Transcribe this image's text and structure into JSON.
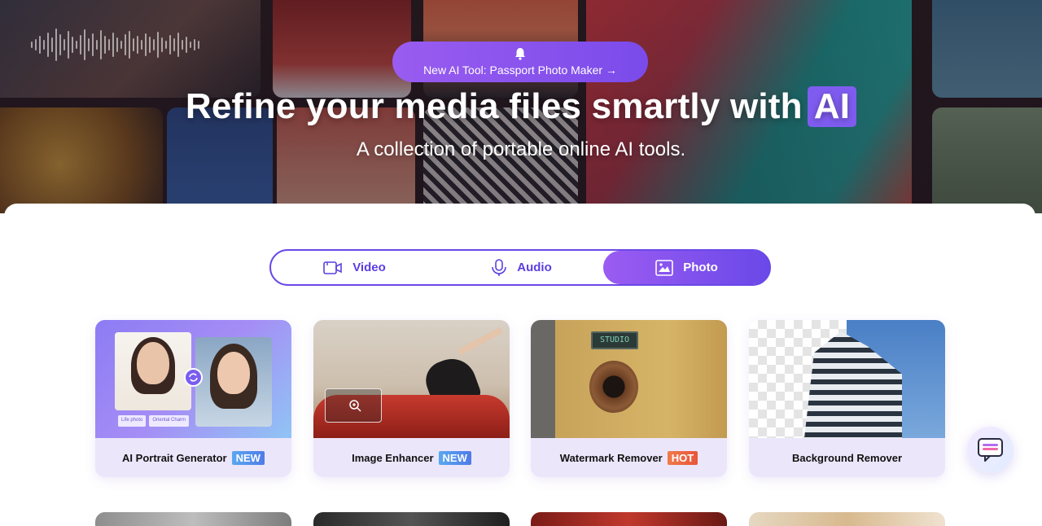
{
  "hero": {
    "announcement": "New AI Tool: Passport Photo Maker →",
    "headline": "Refine your media files smartly with",
    "headline_badge": "AI",
    "subheadline": "A collection of portable online AI tools."
  },
  "tabs": [
    {
      "label": "Video",
      "icon": "video-icon"
    },
    {
      "label": "Audio",
      "icon": "microphone-icon"
    },
    {
      "label": "Photo",
      "icon": "image-icon",
      "active": true
    }
  ],
  "cards": [
    {
      "title": "AI Portrait Generator",
      "badge": "NEW",
      "chips": [
        "Life photo",
        "Oriental Charm"
      ]
    },
    {
      "title": "Image Enhancer",
      "badge": "NEW"
    },
    {
      "title": "Watermark Remover",
      "badge": "HOT",
      "sign_text": "STUDIO"
    },
    {
      "title": "Background Remover",
      "badge": ""
    }
  ],
  "colors": {
    "accent": "#6a48e8",
    "accent_light": "#9b5cf2",
    "badge_new": "#4f7be8",
    "badge_hot": "#e8553a",
    "card_bg": "#ece6fb"
  }
}
